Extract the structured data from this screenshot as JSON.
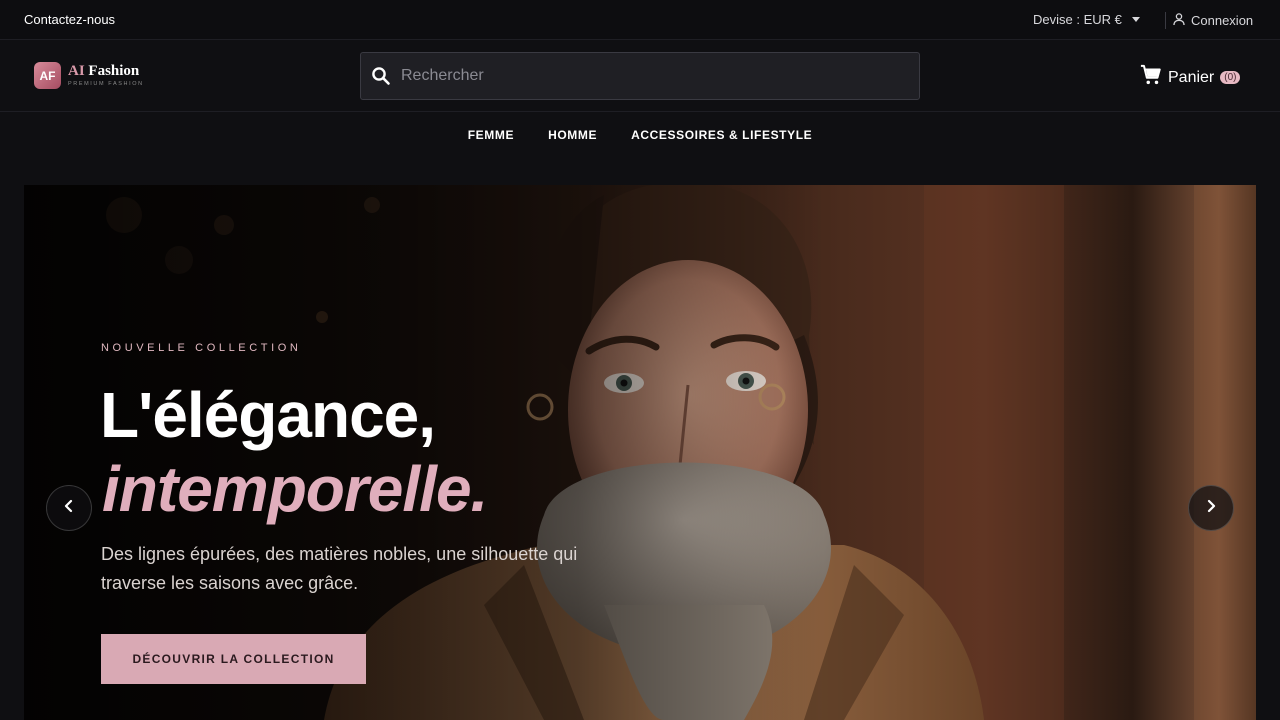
{
  "topbar": {
    "contact": "Contactez-nous",
    "currency": "Devise : EUR €",
    "login": "Connexion"
  },
  "header": {
    "logo_mark": "AF",
    "logo_ai": "AI",
    "logo_name": "Fashion",
    "logo_tagline": "PREMIUM FASHION",
    "search_placeholder": "Rechercher",
    "cart_label": "Panier",
    "cart_count": "(0)"
  },
  "nav": {
    "items": [
      "FEMME",
      "HOMME",
      "ACCESSOIRES & LIFESTYLE"
    ]
  },
  "hero": {
    "kicker": "NOUVELLE COLLECTION",
    "headline_line1": "L'élégance,",
    "headline_line2": "intemporelle.",
    "description": "Des lignes épurées, des matières nobles, une silhouette qui traverse les saisons avec grâce.",
    "cta": "DÉCOUVRIR LA COLLECTION"
  },
  "colors": {
    "accent": "#d9a9b4",
    "headline_italic": "#e0aebc",
    "background": "#0f0f12"
  },
  "icons": {
    "search": "search-icon",
    "cart": "cart-icon",
    "user": "user-icon",
    "prev": "chevron-left-icon",
    "next": "chevron-right-icon"
  }
}
